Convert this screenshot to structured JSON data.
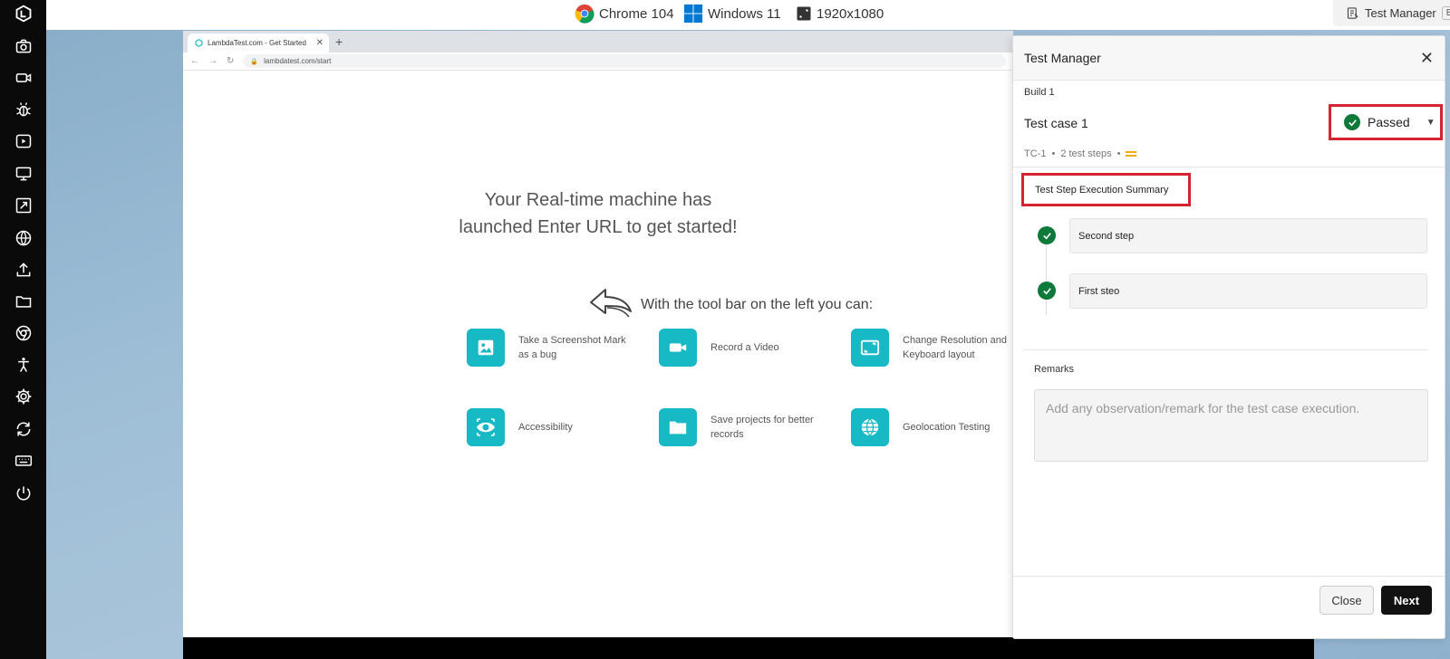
{
  "topbar": {
    "browser_label": "Chrome 104",
    "os_label": "Windows 11",
    "resolution_label": "1920x1080",
    "test_manager_label": "Test Manager",
    "beta_label": "BETA"
  },
  "sidebar": {
    "items": [
      {
        "icon": "logo-icon"
      },
      {
        "icon": "camera-icon"
      },
      {
        "icon": "video-icon"
      },
      {
        "icon": "bug-icon"
      },
      {
        "icon": "play-icon"
      },
      {
        "icon": "monitor-icon"
      },
      {
        "icon": "resize-icon"
      },
      {
        "icon": "globe-icon"
      },
      {
        "icon": "upload-icon"
      },
      {
        "icon": "folder-icon"
      },
      {
        "icon": "chrome-icon"
      },
      {
        "icon": "accessibility-icon"
      },
      {
        "icon": "gear-icon"
      },
      {
        "icon": "switch-icon"
      },
      {
        "icon": "keyboard-icon"
      },
      {
        "icon": "power-icon"
      }
    ]
  },
  "browser": {
    "tab_title": "LambdaTest.com - Get Started",
    "url": "lambdatest.com/start",
    "headline_line1": "Your Real-time machine has",
    "headline_line2": "launched Enter URL to get started!",
    "toolbar_text": "With the tool bar on the left you can:",
    "features": [
      {
        "label": "Take a Screenshot Mark as a bug",
        "icon": "image-icon"
      },
      {
        "label": "Record a Video",
        "icon": "video-icon"
      },
      {
        "label": "Change Resolution and Keyboard layout",
        "icon": "resolution-icon"
      },
      {
        "label": "Accessibility",
        "icon": "eye-icon"
      },
      {
        "label": "Save projects for better records",
        "icon": "folder-icon"
      },
      {
        "label": "Geolocation Testing",
        "icon": "globe-icon"
      }
    ]
  },
  "test_manager": {
    "title": "Test Manager",
    "build": "Build 1",
    "test_case_name": "Test case 1",
    "status": "Passed",
    "tc_id": "TC-1",
    "steps_count": "2 test steps",
    "summary_title": "Test Step Execution Summary",
    "steps": [
      {
        "label": "Second step"
      },
      {
        "label": "First steo"
      }
    ],
    "remarks_label": "Remarks",
    "remarks_placeholder": "Add any observation/remark for the test case execution.",
    "close_label": "Close",
    "next_label": "Next"
  },
  "colors": {
    "accent_teal": "#16b9c4",
    "passed_green": "#0e7a3a",
    "highlight_red": "#d5232f",
    "priority_orange": "#f2a900"
  }
}
